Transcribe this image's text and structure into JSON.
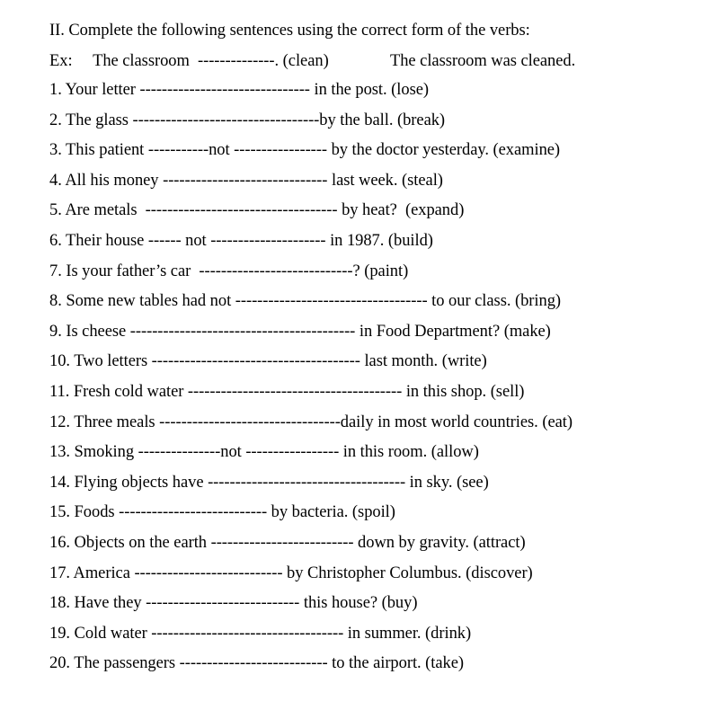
{
  "document": {
    "background_color": "#ffffff",
    "text_color": "#000000",
    "heading": "II. Complete the following sentences using the correct form of the verbs:",
    "example": {
      "label": "Ex:",
      "prompt": "The classroom  --------------. (clean)",
      "answer": "The classroom was cleaned.",
      "full_text": "Ex:     The classroom  --------------. (clean)               The classroom was cleaned."
    },
    "items": [
      {
        "number": "1.",
        "text": "1. Your letter ------------------------------- in the post. (lose)",
        "subject": "Your letter",
        "tail": "in the post.",
        "verb": "(lose)"
      },
      {
        "number": "2.",
        "text": "2. The glass ----------------------------------by the ball. (break)",
        "subject": "The glass",
        "tail": "by the ball.",
        "verb": "(break)"
      },
      {
        "number": "3.",
        "text": "3. This patient -----------not ----------------- by the doctor yesterday. (examine)",
        "subject": "This patient",
        "tail": "by the doctor yesterday.",
        "verb": "(examine)"
      },
      {
        "number": "4.",
        "text": "4. All his money ------------------------------ last week. (steal)",
        "subject": "All his money",
        "tail": "last week.",
        "verb": "(steal)"
      },
      {
        "number": "5.",
        "text": "5. Are metals  ----------------------------------- by heat?  (expand)",
        "subject": "Are metals",
        "tail": "by heat?",
        "verb": "(expand)"
      },
      {
        "number": "6.",
        "text": "6. Their house ------ not --------------------- in 1987. (build)",
        "subject": "Their house",
        "tail": "in 1987.",
        "verb": "(build)"
      },
      {
        "number": "7.",
        "text": "7. Is your father’s car  ----------------------------? (paint)",
        "subject": "Is your father’s car",
        "tail": "?",
        "verb": "(paint)"
      },
      {
        "number": "8.",
        "text": "8. Some new tables had not ----------------------------------- to our class. (bring)",
        "subject": "Some new tables had not",
        "tail": "to our class.",
        "verb": "(bring)"
      },
      {
        "number": "9.",
        "text": "9. Is cheese ----------------------------------------- in Food Department? (make)",
        "subject": "Is cheese",
        "tail": "in Food Department?",
        "verb": "(make)"
      },
      {
        "number": "10.",
        "text": "10. Two letters -------------------------------------- last month. (write)",
        "subject": "Two letters",
        "tail": "last month.",
        "verb": "(write)"
      },
      {
        "number": "11.",
        "text": "11. Fresh cold water --------------------------------------- in this shop. (sell)",
        "subject": "Fresh cold water",
        "tail": "in this shop.",
        "verb": "(sell)"
      },
      {
        "number": "12.",
        "text": "12. Three meals ---------------------------------daily in most world countries. (eat)",
        "subject": "Three meals",
        "tail": "daily in most world countries.",
        "verb": "(eat)"
      },
      {
        "number": "13.",
        "text": "13. Smoking ---------------not ----------------- in this room. (allow)",
        "subject": "Smoking",
        "tail": "in this room.",
        "verb": "(allow)"
      },
      {
        "number": "14.",
        "text": "14. Flying objects have ------------------------------------ in sky. (see)",
        "subject": "Flying objects have",
        "tail": "in sky.",
        "verb": "(see)"
      },
      {
        "number": "15.",
        "text": "15. Foods --------------------------- by bacteria. (spoil)",
        "subject": "Foods",
        "tail": "by bacteria.",
        "verb": "(spoil)"
      },
      {
        "number": "16.",
        "text": "16. Objects on the earth -------------------------- down by gravity. (attract)",
        "subject": "Objects on the earth",
        "tail": "down by gravity.",
        "verb": "(attract)"
      },
      {
        "number": "17.",
        "text": "17. America --------------------------- by Christopher Columbus. (discover)",
        "subject": "America",
        "tail": "by Christopher Columbus.",
        "verb": "(discover)"
      },
      {
        "number": "18.",
        "text": "18. Have they ---------------------------- this house? (buy)",
        "subject": "Have they",
        "tail": "this house?",
        "verb": "(buy)"
      },
      {
        "number": "19.",
        "text": "19. Cold water ----------------------------------- in summer. (drink)",
        "subject": "Cold water",
        "tail": "in summer.",
        "verb": "(drink)"
      },
      {
        "number": "20.",
        "text": "20. The passengers --------------------------- to the airport. (take)",
        "subject": "The passengers",
        "tail": "to the airport.",
        "verb": "(take)"
      }
    ]
  }
}
